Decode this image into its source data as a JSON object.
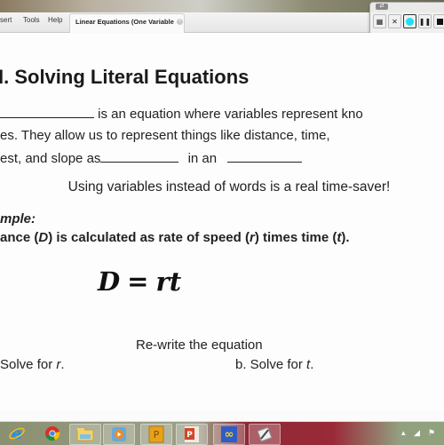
{
  "browser": {
    "menu": [
      "sert",
      "Tools",
      "Help"
    ],
    "tab_title": "Linear Equations (One Variable",
    "tab_close_icon": "close-icon"
  },
  "recorder": {
    "buttons": [
      {
        "name": "grid-icon",
        "glyph": "▦"
      },
      {
        "name": "close-icon",
        "glyph": "✕"
      },
      {
        "name": "record-dot-icon",
        "glyph": "",
        "color": "#1ee0f0"
      },
      {
        "name": "pause-icon",
        "glyph": "❚❚"
      },
      {
        "name": "stop-icon",
        "glyph": ""
      }
    ],
    "restore_icon": "restore-icon"
  },
  "slide": {
    "title": "I.  Solving Literal Equations",
    "para_line1_text": " is an equation where variables represent kno",
    "para_line2": "es.   They allow us to represent things like distance, time,",
    "para_line3_a": "est, and slope as",
    "para_line3_b": " in an ",
    "tagline": "Using variables instead of words is a real time-saver!",
    "example_label": "mple:",
    "example_text_parts": [
      "ance (",
      "D",
      ") is calculated as rate of speed (",
      "r",
      ") times time (",
      "t",
      ")."
    ],
    "equation": {
      "lhs": "D",
      "eq": "=",
      "rhs": "rt"
    },
    "rewrite": "Re-write the equation",
    "part_a": "Solve for ",
    "part_a_var": "r",
    "part_a_end": ".",
    "part_b": "b.  Solve for ",
    "part_b_var": "t",
    "part_b_end": "."
  },
  "taskbar": {
    "apps": [
      "internet-explorer-icon",
      "chrome-icon",
      "file-explorer-icon",
      "media-player-icon",
      "publisher-icon",
      "powerpoint-icon",
      "infinity-app-icon",
      "snipping-tool-icon"
    ],
    "tray": [
      "show-hidden-icons",
      "signal-icon",
      "flag-icon"
    ]
  }
}
